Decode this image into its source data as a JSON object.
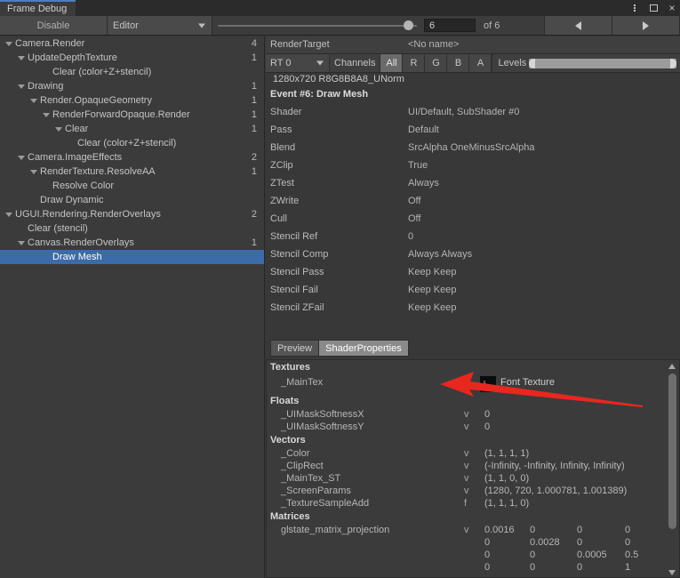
{
  "window": {
    "tab_title": "Frame Debug",
    "controls": {
      "menu": "more-options",
      "maximize": "maximize",
      "close": "×"
    }
  },
  "toolbar": {
    "disable_label": "Disable",
    "target_label": "Editor",
    "event_index": "6",
    "event_total": "of 6",
    "prev_label": "◀",
    "next_label": "▶"
  },
  "tree": {
    "rows": [
      {
        "label": "Camera.Render",
        "indent": 0,
        "arrow": true,
        "count": "4"
      },
      {
        "label": "UpdateDepthTexture",
        "indent": 1,
        "arrow": true,
        "count": "1"
      },
      {
        "label": "Clear (color+Z+stencil)",
        "indent": 3,
        "arrow": false,
        "count": ""
      },
      {
        "label": "Drawing",
        "indent": 1,
        "arrow": true,
        "count": "1"
      },
      {
        "label": "Render.OpaqueGeometry",
        "indent": 2,
        "arrow": true,
        "count": "1"
      },
      {
        "label": "RenderForwardOpaque.Render",
        "indent": 3,
        "arrow": true,
        "count": "1"
      },
      {
        "label": "Clear",
        "indent": 4,
        "arrow": true,
        "count": "1"
      },
      {
        "label": "Clear (color+Z+stencil)",
        "indent": 5,
        "arrow": false,
        "count": ""
      },
      {
        "label": "Camera.ImageEffects",
        "indent": 1,
        "arrow": true,
        "count": "2"
      },
      {
        "label": "RenderTexture.ResolveAA",
        "indent": 2,
        "arrow": true,
        "count": "1"
      },
      {
        "label": "Resolve Color",
        "indent": 3,
        "arrow": false,
        "count": ""
      },
      {
        "label": "Draw Dynamic",
        "indent": 2,
        "arrow": false,
        "count": ""
      },
      {
        "label": "UGUI.Rendering.RenderOverlays",
        "indent": 0,
        "arrow": true,
        "count": "2"
      },
      {
        "label": "Clear (stencil)",
        "indent": 1,
        "arrow": false,
        "count": ""
      },
      {
        "label": "Canvas.RenderOverlays",
        "indent": 1,
        "arrow": true,
        "count": "1"
      },
      {
        "label": "Draw Mesh",
        "indent": 3,
        "arrow": false,
        "count": "",
        "selected": true
      }
    ]
  },
  "details": {
    "render_target_label": "RenderTarget",
    "render_target_value": "<No name>",
    "rt_select": "RT 0",
    "channels_label": "Channels",
    "channels": [
      "All",
      "R",
      "G",
      "B",
      "A"
    ],
    "channel_active": "All",
    "levels_label": "Levels",
    "format_line": "1280x720 R8G8B8A8_UNorm",
    "event_title": "Event #6: Draw Mesh",
    "state_rows": [
      {
        "key": "Shader",
        "value": "UI/Default, SubShader #0"
      },
      {
        "key": "Pass",
        "value": "Default"
      },
      {
        "key": "Blend",
        "value": "SrcAlpha OneMinusSrcAlpha"
      },
      {
        "key": "ZClip",
        "value": "True"
      },
      {
        "key": "ZTest",
        "value": "Always"
      },
      {
        "key": "ZWrite",
        "value": "Off"
      },
      {
        "key": "Cull",
        "value": "Off"
      },
      {
        "key": "Stencil Ref",
        "value": "0"
      },
      {
        "key": "Stencil Comp",
        "value": "Always Always"
      },
      {
        "key": "Stencil Pass",
        "value": "Keep Keep"
      },
      {
        "key": "Stencil Fail",
        "value": "Keep Keep"
      },
      {
        "key": "Stencil ZFail",
        "value": "Keep Keep"
      }
    ]
  },
  "panel_tabs": [
    {
      "label": "Preview",
      "active": false
    },
    {
      "label": "ShaderProperties",
      "active": true
    }
  ],
  "shader_properties": {
    "textures_header": "Textures",
    "textures": [
      {
        "name": "_MainTex",
        "type": "f",
        "value": "Font Texture"
      }
    ],
    "floats_header": "Floats",
    "floats": [
      {
        "name": "_UIMaskSoftnessX",
        "type": "v",
        "value": "0"
      },
      {
        "name": "_UIMaskSoftnessY",
        "type": "v",
        "value": "0"
      }
    ],
    "vectors_header": "Vectors",
    "vectors": [
      {
        "name": "_Color",
        "type": "v",
        "value": "(1, 1, 1, 1)"
      },
      {
        "name": "_ClipRect",
        "type": "v",
        "value": "(-Infinity, -Infinity, Infinity, Infinity)"
      },
      {
        "name": "_MainTex_ST",
        "type": "v",
        "value": "(1, 1, 0, 0)"
      },
      {
        "name": "_ScreenParams",
        "type": "v",
        "value": "(1280, 720, 1.000781, 1.001389)"
      },
      {
        "name": "_TextureSampleAdd",
        "type": "f",
        "value": "(1, 1, 1, 0)"
      }
    ],
    "matrices_header": "Matrices",
    "matrices": [
      {
        "name": "glstate_matrix_projection",
        "type": "v",
        "rows": [
          [
            "0.0016",
            "0",
            "0",
            "0"
          ],
          [
            "0",
            "0.0028",
            "0",
            "0"
          ],
          [
            "0",
            "0",
            "0.0005",
            "0.5"
          ],
          [
            "0",
            "0",
            "0",
            "1"
          ]
        ]
      }
    ]
  },
  "annotation": {
    "arrow_color": "#e8271f",
    "points_at": "Font Texture"
  },
  "colors": {
    "background": "#383838",
    "panel": "#3b3b3b",
    "selection": "#3c6ba8",
    "tab_accent": "#4b7fc0"
  }
}
